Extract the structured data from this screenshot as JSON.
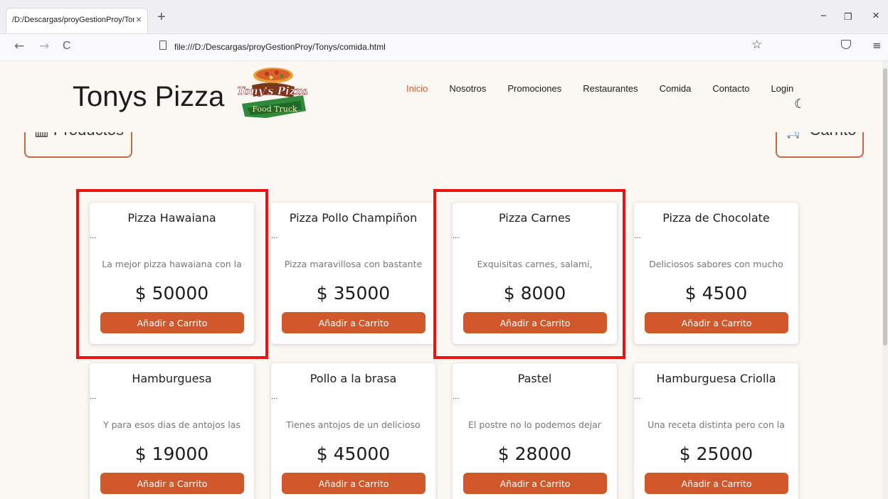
{
  "browser": {
    "tab_title": "/D:/Descargas/proyGestionProy/Tonys/comida.html",
    "tab_close": "×",
    "new_tab": "+",
    "minimize": "−",
    "restore": "❐",
    "close": "×",
    "back": "←",
    "forward": "→",
    "reload": "C",
    "url": "file:///D:/Descargas/proyGestionProy/Tonys/comida.html",
    "bookmark": "☆",
    "menu": "≡"
  },
  "header": {
    "brand": "Tonys Pizza",
    "logo_text_1": "Tony's Pizza",
    "logo_text_2": "Food Truck",
    "nav": [
      "Inicio",
      "Nosotros",
      "Promociones",
      "Restaurantes",
      "Comida",
      "Contacto",
      "Login"
    ],
    "theme_toggle": "☾"
  },
  "buttons": {
    "productos": "▥ Productos",
    "carrito": "🛒 Carrito"
  },
  "products": [
    {
      "name": "Pizza Hawaiana",
      "desc": "La mejor pizza hawaiana con la",
      "price": "$ 50000",
      "button": "Añadir a Carrito",
      "dots": "..."
    },
    {
      "name": "Pizza Pollo Champiñon",
      "desc": "Pizza maravillosa con bastante",
      "price": "$ 35000",
      "button": "Añadir a Carrito",
      "dots": "..."
    },
    {
      "name": "Pizza Carnes",
      "desc": "Exquisitas carnes, salami,",
      "price": "$ 8000",
      "button": "Añadir a Carrito",
      "dots": "..."
    },
    {
      "name": "Pizza de Chocolate",
      "desc": "Deliciosos sabores con mucho",
      "price": "$ 4500",
      "button": "Añadir a Carrito",
      "dots": "..."
    },
    {
      "name": "Hamburguesa",
      "desc": "Y para esos dias de antojos las",
      "price": "$ 19000",
      "button": "Añadir a Carrito",
      "dots": "..."
    },
    {
      "name": "Pollo a la brasa",
      "desc": "Tienes antojos de un delicioso",
      "price": "$ 45000",
      "button": "Añadir a Carrito",
      "dots": "..."
    },
    {
      "name": "Pastel",
      "desc": "El postre no lo podemos dejar",
      "price": "$ 28000",
      "button": "Añadir a Carrito",
      "dots": "..."
    },
    {
      "name": "Hamburguesa Criolla",
      "desc": "Una receta distinta pero con la",
      "price": "$ 25000",
      "button": "Añadir a Carrito",
      "dots": "..."
    }
  ],
  "colors": {
    "accent": "#d0582a",
    "active_nav": "#d45a2a",
    "highlight": "#ee1111"
  }
}
